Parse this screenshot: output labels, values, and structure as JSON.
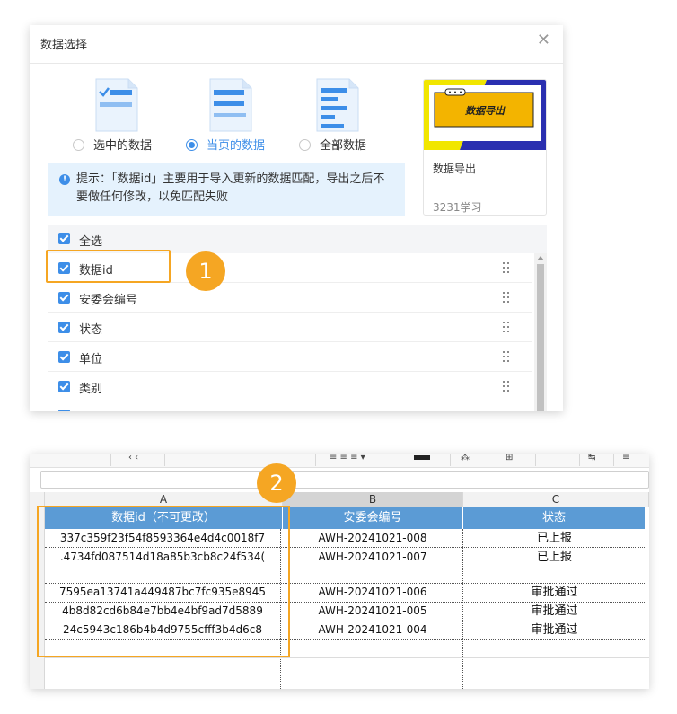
{
  "dialog": {
    "title": "数据选择",
    "close_icon": "close-icon",
    "options": [
      {
        "label": "选中的数据",
        "selected": false
      },
      {
        "label": "当页的数据",
        "selected": true
      },
      {
        "label": "全部数据",
        "selected": false
      }
    ],
    "tip": "提示：「数据id」主要用于导入更新的数据匹配，导出之后不要做任何修改，以免匹配失败",
    "card": {
      "thumb_text": "数据导出",
      "title": "数据导出",
      "meta": "3231学习"
    },
    "select_all": "全选",
    "fields": [
      "数据id",
      "安委会编号",
      "状态",
      "单位",
      "类别"
    ]
  },
  "badges": {
    "one": "1",
    "two": "2"
  },
  "sheet": {
    "columns": [
      "A",
      "B",
      "C"
    ],
    "headers": [
      "数据id（不可更改）",
      "安委会编号",
      "状态"
    ],
    "rows": [
      {
        "id": "337c359f23f54f8593364e4d4c0018f7",
        "code": "AWH-20241021-008",
        "status": "已上报"
      },
      {
        "id": ".4734fd087514d18a85b3cb8c24f534(",
        "code": "AWH-20241021-007",
        "status": "已上报"
      },
      {
        "id": "7595ea13741a449487bc7fc935e8945",
        "code": "AWH-20241021-006",
        "status": "审批通过"
      },
      {
        "id": "4b8d82cd6b84e7bb4e4bf9ad7d5889",
        "code": "AWH-20241021-005",
        "status": "审批通过"
      },
      {
        "id": "24c5943c186b4b4d9755cfff3b4d6c8",
        "code": "AWH-20241021-004",
        "status": "审批通过"
      }
    ]
  },
  "colors": {
    "accent": "#3d8ee8",
    "highlight": "#f5a623",
    "header_blue": "#5b9bd5",
    "tip_bg": "#e5f2fd"
  }
}
